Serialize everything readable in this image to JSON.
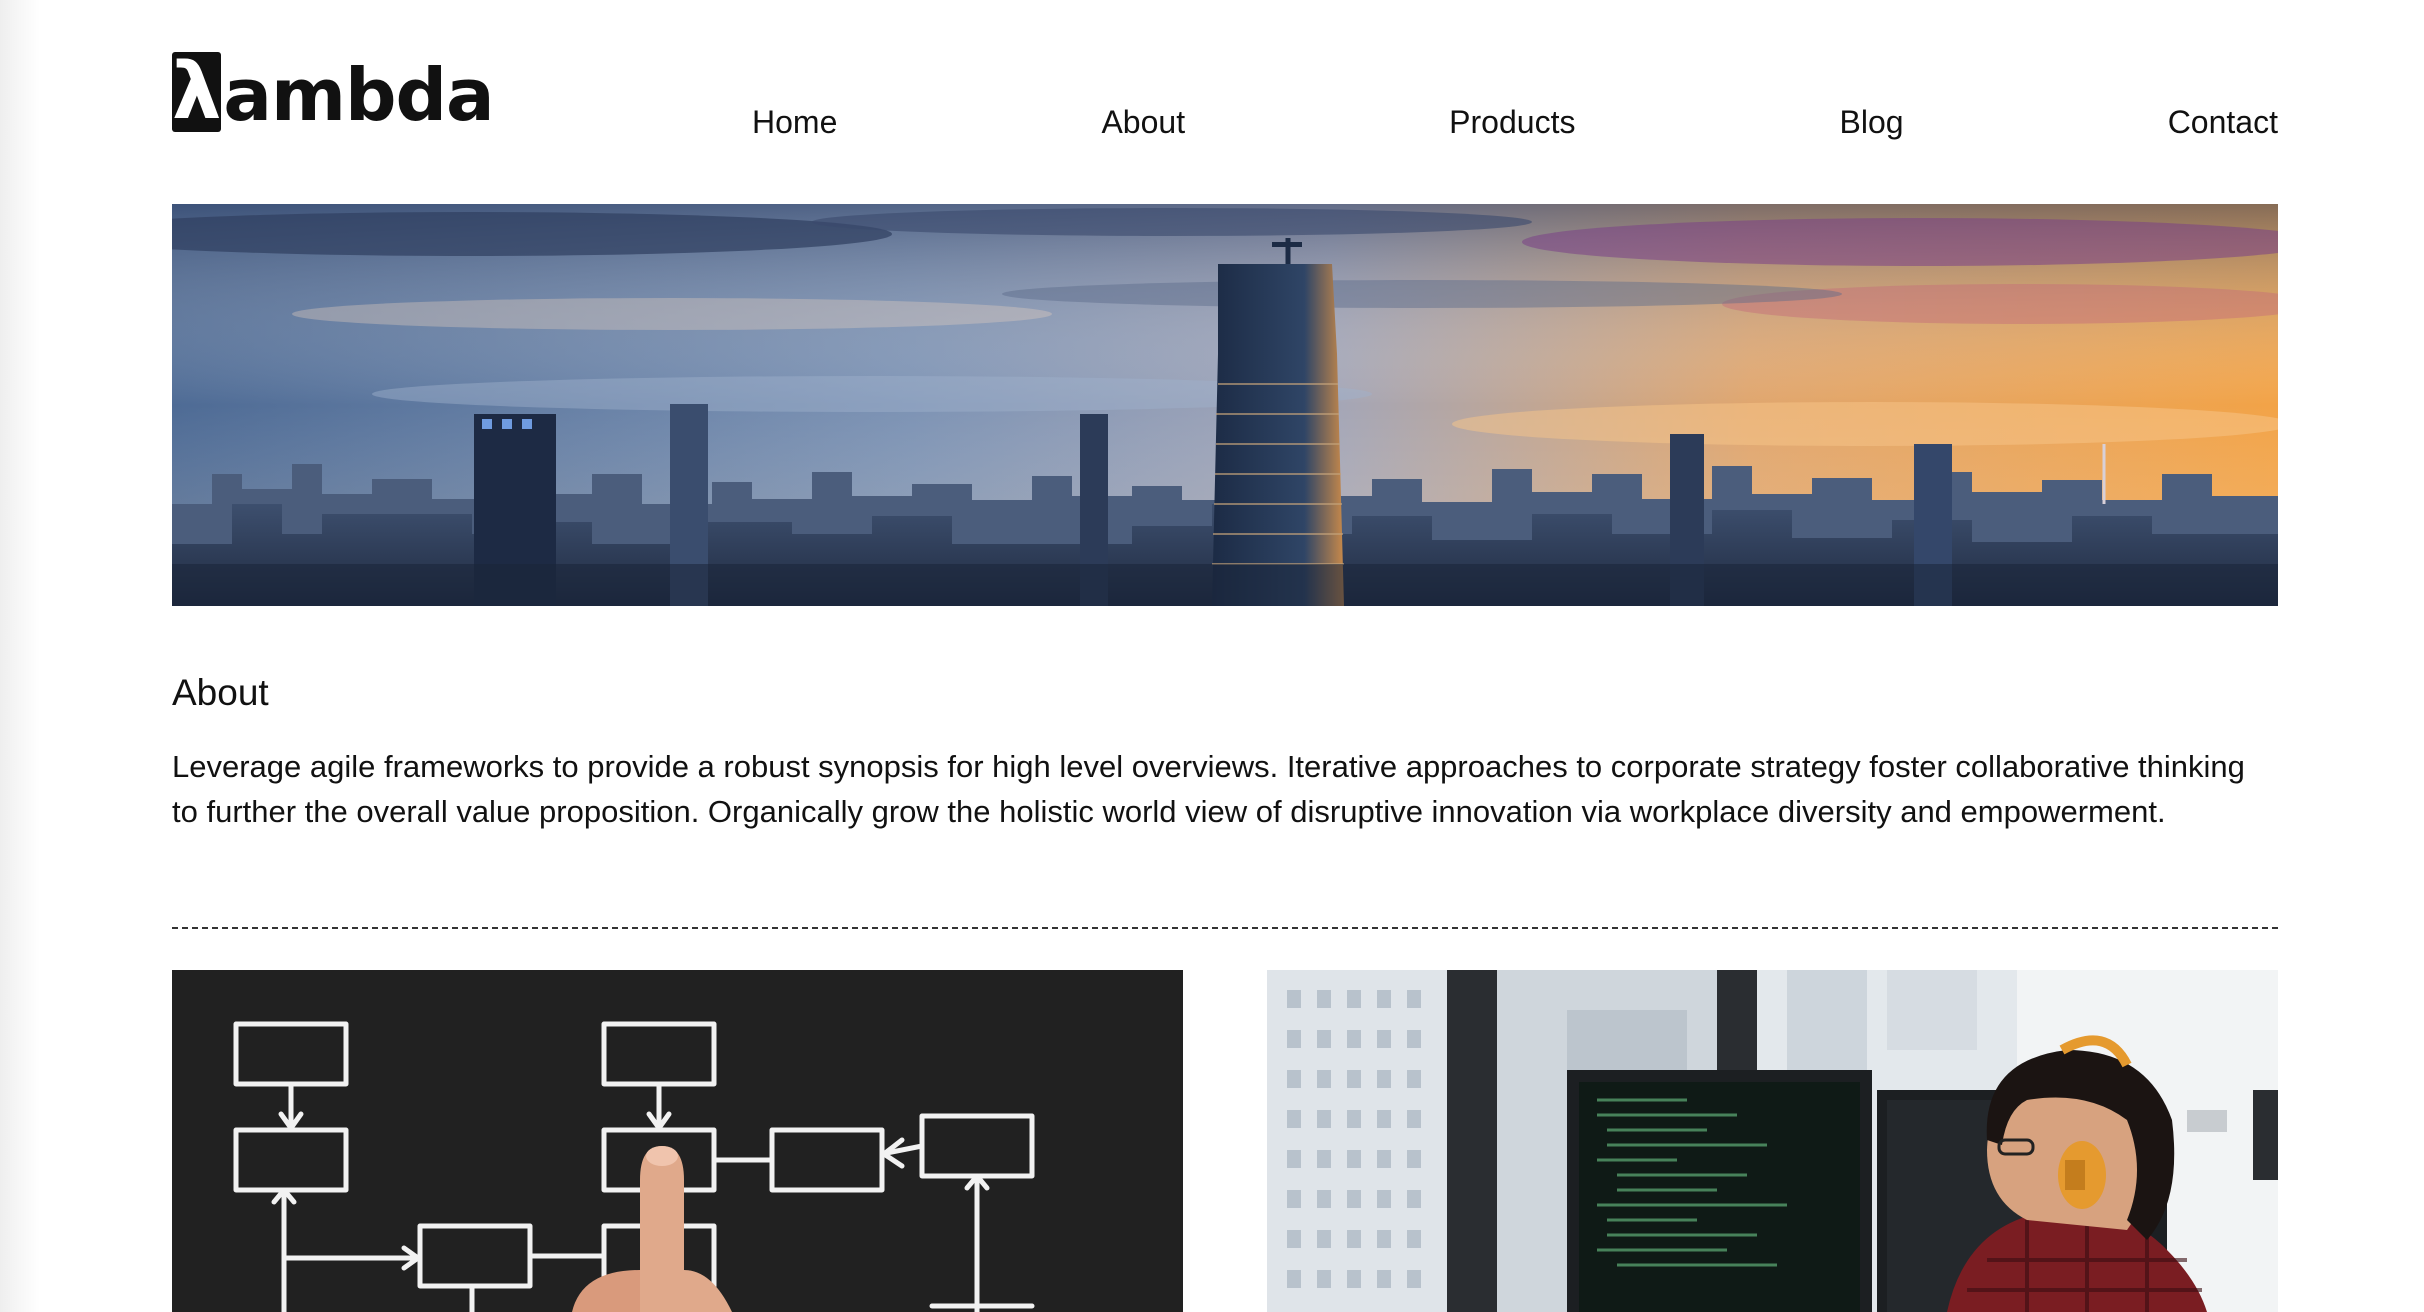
{
  "logo": {
    "symbol": "λ",
    "text": "ambda"
  },
  "nav": {
    "items": [
      {
        "label": "Home"
      },
      {
        "label": "About"
      },
      {
        "label": "Products"
      },
      {
        "label": "Blog"
      },
      {
        "label": "Contact"
      }
    ]
  },
  "hero": {
    "image": "city-skyline-sunset"
  },
  "about": {
    "title": "About",
    "text": "Leverage agile frameworks to provide a robust synopsis for high level overviews. Iterative approaches to corporate strategy foster collaborative thinking to further the overall value proposition. Organically grow the holistic world view of disruptive innovation via workplace diversity and empowerment."
  },
  "cards": [
    {
      "image": "flowchart-chalkboard-photo"
    },
    {
      "image": "developer-at-monitors-photo"
    }
  ],
  "colors": {
    "text": "#111111",
    "background": "#ffffff",
    "chalkboard": "#212121"
  }
}
